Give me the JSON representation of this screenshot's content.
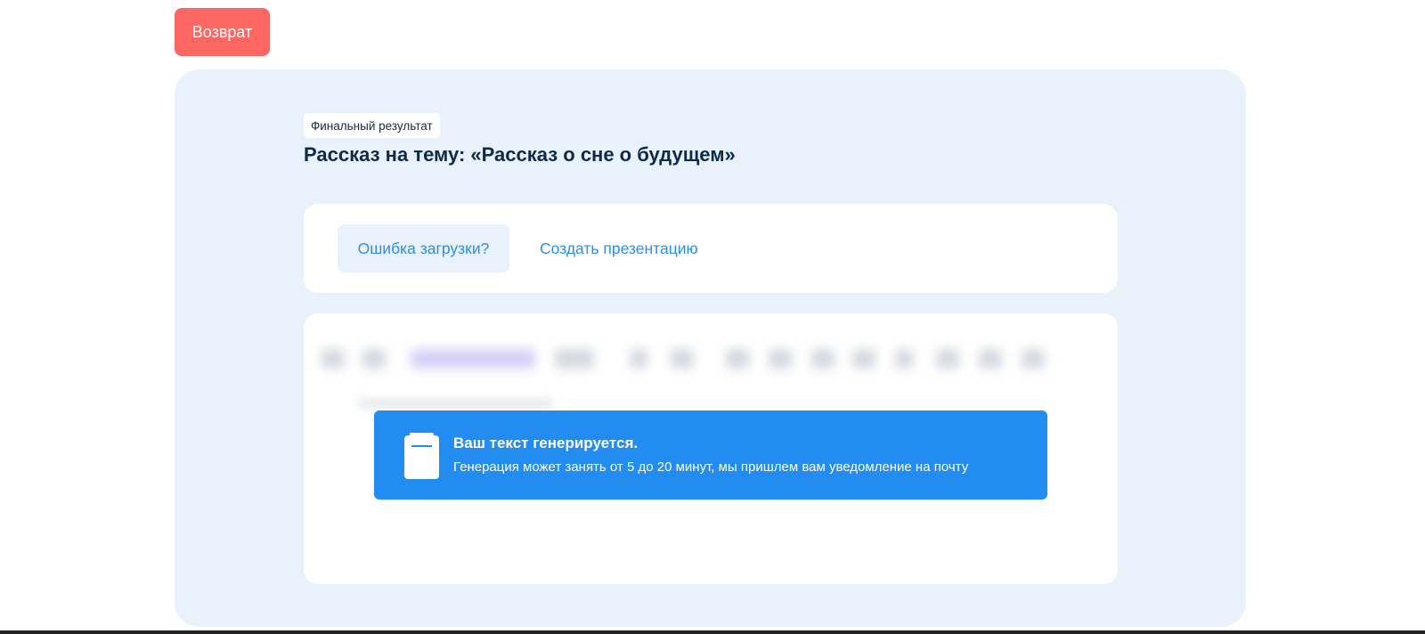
{
  "header": {
    "back_label": "Возврат"
  },
  "result": {
    "badge": "Финальный результат",
    "title": "Рассказ на тему: «Рассказ о сне о будущем»"
  },
  "actions": {
    "error_label": "Ошибка загрузки?",
    "presentation_label": "Создать презентацию"
  },
  "notice": {
    "title": "Ваш текст генерируется.",
    "text": "Генерация может занять от 5 до 20 минут, мы пришлем вам уведомление на почту",
    "icon": "notepad-icon"
  },
  "colors": {
    "back_button": "#fc6764",
    "panel_background": "#e9f1fa",
    "title": "#0e2a4a",
    "link": "#2f8ee8",
    "notice_background": "#238cf0"
  }
}
